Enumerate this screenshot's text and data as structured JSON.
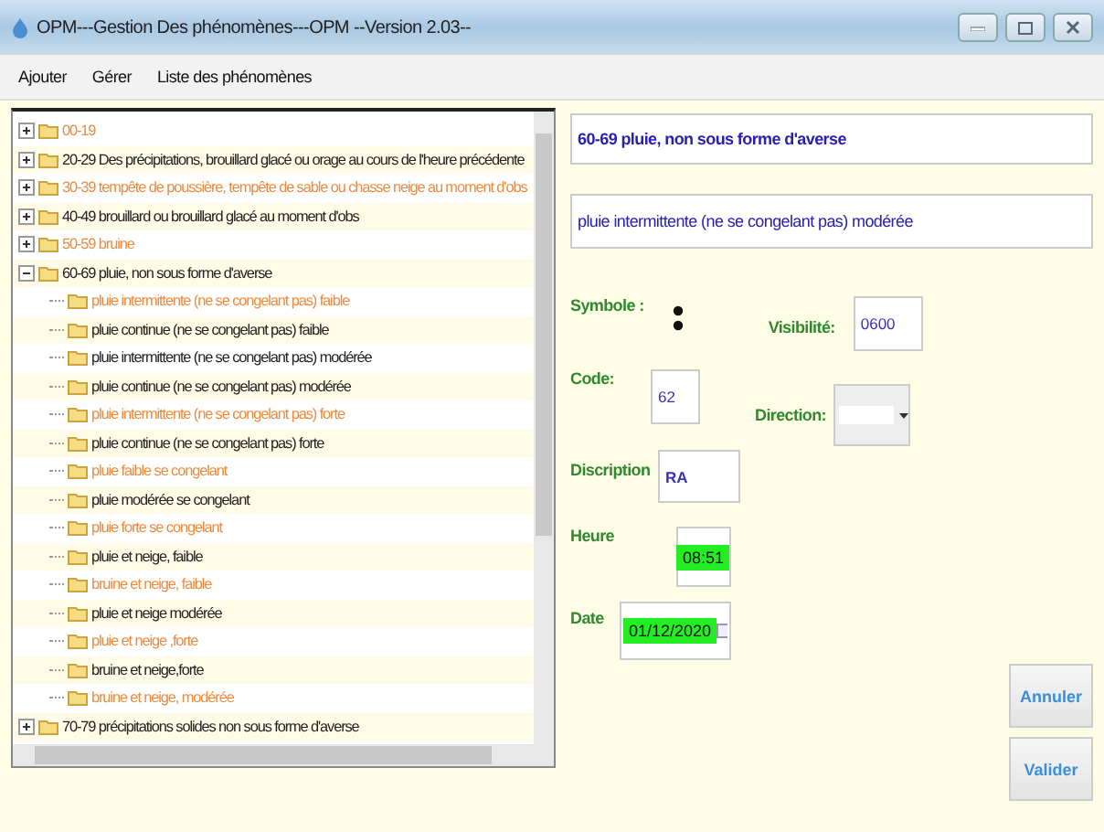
{
  "window": {
    "title": "OPM---Gestion Des phénomènes---OPM --Version 2.03--"
  },
  "menu": [
    "Ajouter",
    "Gérer",
    "Liste des phénomènes"
  ],
  "tree": [
    {
      "label": "00-19",
      "color": "#f08a3c",
      "expanded": false
    },
    {
      "label": "20-29 Des précipitations, brouillard glacé ou orage au cours de l'heure précédente",
      "color": "#222222",
      "expanded": false
    },
    {
      "label": "30-39 tempête de poussière, tempête de sable ou chasse neige au moment d'obs",
      "color": "#f08a3c",
      "expanded": false
    },
    {
      "label": "40-49 brouillard ou brouillard glacé au moment d'obs",
      "color": "#222222",
      "expanded": false
    },
    {
      "label": "50-59 bruine",
      "color": "#f08a3c",
      "expanded": false
    },
    {
      "label": "60-69 pluie, non sous forme d'averse",
      "color": "#222222",
      "expanded": true,
      "children": [
        {
          "label": "pluie intermittente (ne se congelant pas) faible",
          "color": "#f08a3c"
        },
        {
          "label": "pluie continue (ne se congelant pas) faible",
          "color": "#222222"
        },
        {
          "label": "pluie intermittente (ne se congelant pas) modérée",
          "color": "#222222"
        },
        {
          "label": "pluie continue (ne se congelant pas) modérée",
          "color": "#222222"
        },
        {
          "label": "pluie intermittente (ne se congelant pas) forte",
          "color": "#f08a3c"
        },
        {
          "label": "pluie continue (ne se congelant pas) forte",
          "color": "#222222"
        },
        {
          "label": "pluie faible se congelant",
          "color": "#f08a3c"
        },
        {
          "label": "pluie modérée se congelant",
          "color": "#222222"
        },
        {
          "label": "pluie forte se congelant",
          "color": "#f08a3c"
        },
        {
          "label": "pluie et neige, faible",
          "color": "#222222"
        },
        {
          "label": "bruine et neige, faible",
          "color": "#f08a3c"
        },
        {
          "label": "pluie et neige  modérée",
          "color": "#222222"
        },
        {
          "label": "pluie et neige ,forte",
          "color": "#f08a3c"
        },
        {
          "label": "bruine et neige,forte",
          "color": "#222222"
        },
        {
          "label": "bruine et neige, modérée",
          "color": "#f08a3c"
        }
      ]
    },
    {
      "label": "70-79 précipitations solides non sous forme d'averse",
      "color": "#222222",
      "expanded": false
    }
  ],
  "form": {
    "group": "60-69 pluie, non sous forme d'averse",
    "phenomenon": "pluie intermittente (ne se congelant pas) modérée",
    "symbol_label": "Symbole :",
    "visibility_label": "Visibilité:",
    "visibility": "0600",
    "code_label": "Code:",
    "code": "62",
    "direction_label": "Direction:",
    "description_label": "Discription",
    "description": "RA",
    "time_label": "Heure",
    "time": "08:51",
    "date_label": "Date",
    "date": "01/12/2020"
  },
  "buttons": [
    "Annuler",
    "Valider"
  ]
}
